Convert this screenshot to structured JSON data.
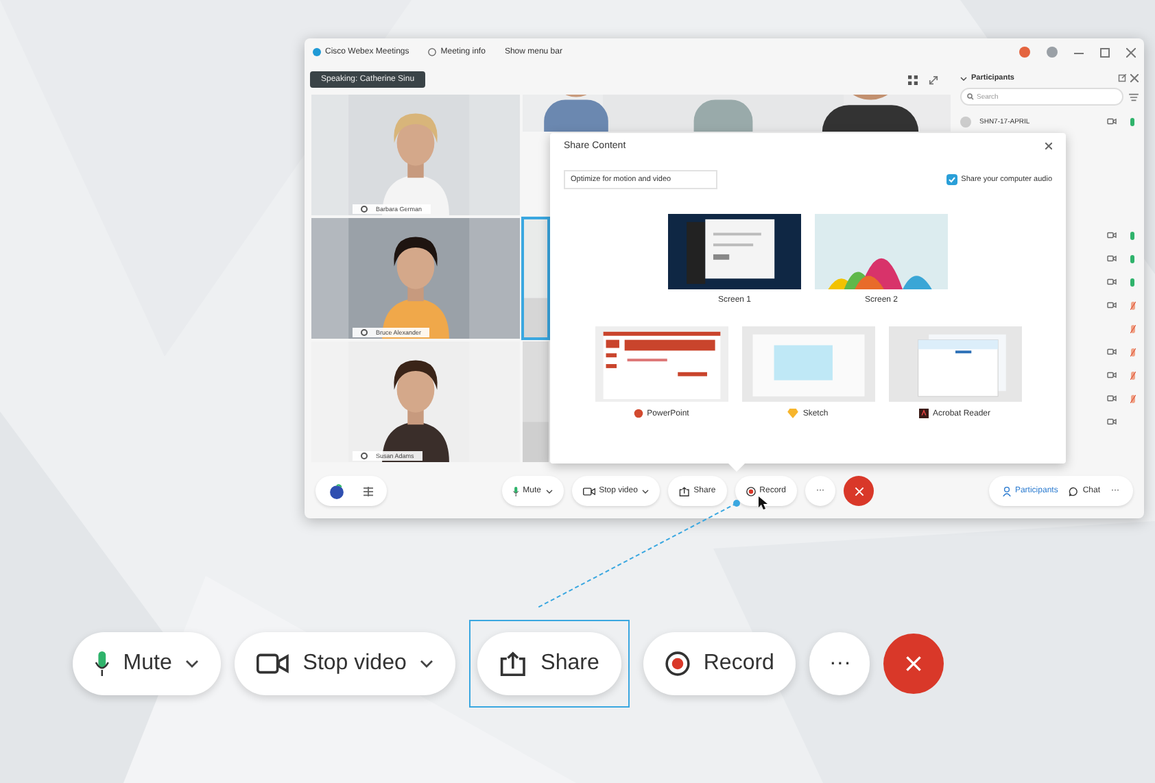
{
  "window": {
    "app_name": "Cisco Webex Meetings",
    "meeting_info": "Meeting info",
    "menu_toggle": "Show menu bar"
  },
  "speaking_banner": "Speaking: Catherine Sinu",
  "video_tiles": [
    {
      "name": "Barbara German",
      "selected": false,
      "kind": "woman-blond"
    },
    {
      "selected": false,
      "kind": "group"
    },
    {
      "name": "Bruce Alexander",
      "selected": false,
      "kind": "person-yellow"
    },
    {
      "selected": true,
      "kind": "office"
    },
    {
      "name": "Susan Adams",
      "selected": false,
      "kind": "woman-dark"
    },
    {
      "selected": false,
      "kind": "plain"
    }
  ],
  "participants": {
    "title": "Participants",
    "search_placeholder": "Search",
    "rows": [
      {
        "name": "SHN7-17-APRIL",
        "camera": true,
        "mic": true,
        "muted": false
      },
      {
        "camera": true,
        "mic": true,
        "muted": false
      },
      {
        "camera": true,
        "mic": true,
        "muted": false
      },
      {
        "camera": true,
        "mic": true,
        "muted": false
      },
      {
        "camera": true,
        "mic": true,
        "muted": true
      },
      {
        "camera": false,
        "mic": true,
        "muted": true
      },
      {
        "camera": true,
        "mic": true,
        "muted": true
      },
      {
        "camera": true,
        "mic": true,
        "muted": true
      },
      {
        "camera": true,
        "mic": true,
        "muted": true
      },
      {
        "camera": true,
        "mic": false
      }
    ]
  },
  "share_dialog": {
    "title": "Share Content",
    "optimize": "Optimize for motion and video",
    "share_audio": {
      "label": "Share your computer audio",
      "checked": true
    },
    "screens": [
      {
        "label": "Screen 1",
        "kind": "desktop"
      },
      {
        "label": "Screen 2",
        "kind": "chart"
      }
    ],
    "apps": [
      {
        "label": "PowerPoint",
        "kind": "slides"
      },
      {
        "label": "Sketch",
        "kind": "canvas"
      },
      {
        "label": "Acrobat Reader",
        "kind": "document"
      }
    ]
  },
  "control_bar": {
    "controls": [
      {
        "label": "Mute",
        "kind": "mute",
        "selected": false
      },
      {
        "label": "Stop video",
        "kind": "video",
        "selected": false
      },
      {
        "label": "Share",
        "kind": "share",
        "selected": false
      },
      {
        "label": "Record",
        "kind": "record",
        "selected": false
      },
      {
        "label": "···",
        "kind": "more",
        "selected": false
      },
      {
        "kind": "end",
        "selected": false
      }
    ],
    "panel_buttons": [
      {
        "label": "Participants",
        "selected": true
      },
      {
        "label": "Chat",
        "selected": false
      }
    ],
    "more_label": "···"
  },
  "large_controls": [
    {
      "label": "Mute",
      "kind": "mute",
      "selected": false
    },
    {
      "label": "Stop video",
      "kind": "video",
      "selected": false
    },
    {
      "label": "Share",
      "kind": "share",
      "selected": true
    },
    {
      "label": "Record",
      "kind": "record",
      "selected": false
    },
    {
      "label": "···",
      "kind": "more",
      "selected": false
    },
    {
      "kind": "end",
      "selected": false
    }
  ]
}
